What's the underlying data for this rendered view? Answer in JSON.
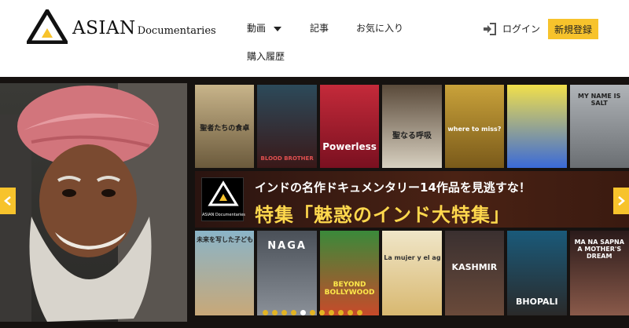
{
  "logo": {
    "main": "ASIAN",
    "sub": "Documentaries"
  },
  "nav": {
    "videos": "動画",
    "articles": "記事",
    "favorites": "お気に入り",
    "history": "購入履歴"
  },
  "header": {
    "login": "ログイン",
    "signup": "新規登録"
  },
  "colors": {
    "accent": "#f7c32c",
    "banner_highlight": "#ffd84d",
    "hero_bg": "#161210"
  },
  "hero": {
    "banner": {
      "logo_text": "ASIAN Documentaries",
      "line1": "インドの名作ドキュメンタリー14作品を見逃すな！",
      "line2": "特集「魅惑のインド大特集」"
    },
    "posters_top": [
      {
        "title": "聖者たちの食卓"
      },
      {
        "title": "BLOOD BROTHER"
      },
      {
        "title": "Powerless"
      },
      {
        "title": "聖なる呼吸"
      },
      {
        "title": "where to miss?"
      },
      {
        "title": ""
      },
      {
        "title": "MY NAME IS SALT"
      }
    ],
    "posters_bottom": [
      {
        "title": "未来を写した子どもたち"
      },
      {
        "title": "NAGA"
      },
      {
        "title": "BEYOND BOLLYWOOD"
      },
      {
        "title": "La mujer y el agua"
      },
      {
        "title": "KASHMIR"
      },
      {
        "title": "BHOPALI"
      },
      {
        "title": "MA NA SAPNA A MOTHER'S DREAM"
      }
    ],
    "prev_icon": "chevron-left-icon",
    "next_icon": "chevron-right-icon",
    "slide_count": 11,
    "active_slide": 4
  }
}
